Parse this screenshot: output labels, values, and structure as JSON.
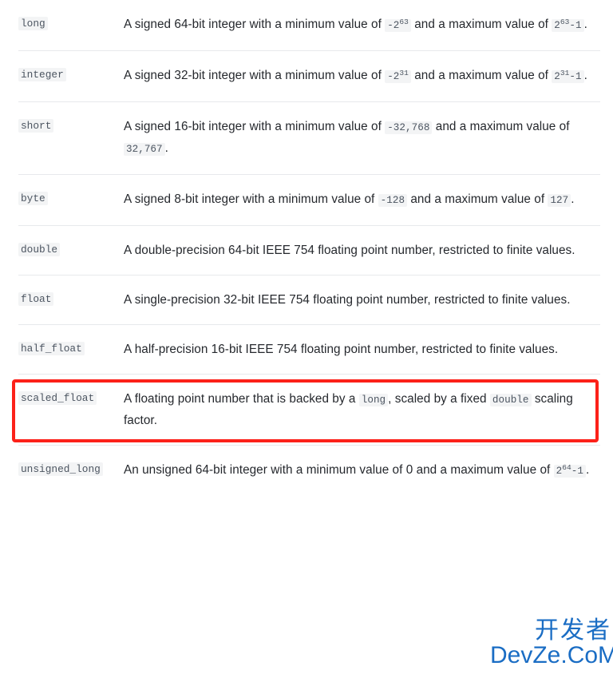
{
  "page": {
    "kind": "documentation-field-datatypes-table",
    "highlight_color": "#fc2119",
    "divider_color": "#e7e9ec",
    "code_chip_bg": "#f3f4f5",
    "code_chip_fg": "#4c5561",
    "body_text_color": "#25282d"
  },
  "watermark": {
    "line1": "开发者",
    "line2": "DevZe.CoM",
    "color": "#1a6dc4"
  },
  "rows": [
    {
      "term": "long",
      "highlighted": false,
      "desc_parts": [
        {
          "type": "text",
          "value": "A signed 64-bit integer with a minimum value of "
        },
        {
          "type": "code_pow",
          "base": "-2",
          "exp": "63",
          "tail": ""
        },
        {
          "type": "text",
          "value": " and a maximum value of "
        },
        {
          "type": "code_pow",
          "base": "2",
          "exp": "63",
          "tail": "-1"
        },
        {
          "type": "text",
          "value": "."
        }
      ],
      "desc_plain": "A signed 64-bit integer with a minimum value of -2^63 and a maximum value of 2^63-1."
    },
    {
      "term": "integer",
      "highlighted": false,
      "desc_parts": [
        {
          "type": "text",
          "value": "A signed 32-bit integer with a minimum value of "
        },
        {
          "type": "code_pow",
          "base": "-2",
          "exp": "31",
          "tail": ""
        },
        {
          "type": "text",
          "value": " and a maximum value of "
        },
        {
          "type": "code_pow",
          "base": "2",
          "exp": "31",
          "tail": "-1"
        },
        {
          "type": "text",
          "value": "."
        }
      ],
      "desc_plain": "A signed 32-bit integer with a minimum value of -2^31 and a maximum value of 2^31-1."
    },
    {
      "term": "short",
      "highlighted": false,
      "desc_parts": [
        {
          "type": "text",
          "value": "A signed 16-bit integer with a minimum value of "
        },
        {
          "type": "code",
          "value": "-32,768"
        },
        {
          "type": "text",
          "value": " and a maximum value of "
        },
        {
          "type": "code",
          "value": "32,767"
        },
        {
          "type": "text",
          "value": "."
        }
      ],
      "desc_plain": "A signed 16-bit integer with a minimum value of -32,768 and a maximum value of 32,767."
    },
    {
      "term": "byte",
      "highlighted": false,
      "desc_parts": [
        {
          "type": "text",
          "value": "A signed 8-bit integer with a minimum value of "
        },
        {
          "type": "code",
          "value": "-128"
        },
        {
          "type": "text",
          "value": " and a maximum value of "
        },
        {
          "type": "code",
          "value": "127"
        },
        {
          "type": "text",
          "value": "."
        }
      ],
      "desc_plain": "A signed 8-bit integer with a minimum value of -128 and a maximum value of 127."
    },
    {
      "term": "double",
      "highlighted": false,
      "desc_parts": [
        {
          "type": "text",
          "value": "A double-precision 64-bit IEEE 754 floating point number, restricted to finite values."
        }
      ],
      "desc_plain": "A double-precision 64-bit IEEE 754 floating point number, restricted to finite values."
    },
    {
      "term": "float",
      "highlighted": false,
      "desc_parts": [
        {
          "type": "text",
          "value": "A single-precision 32-bit IEEE 754 floating point number, restricted to finite values."
        }
      ],
      "desc_plain": "A single-precision 32-bit IEEE 754 floating point number, restricted to finite values."
    },
    {
      "term": "half_float",
      "highlighted": false,
      "desc_parts": [
        {
          "type": "text",
          "value": "A half-precision 16-bit IEEE 754 floating point number, restricted to finite values."
        }
      ],
      "desc_plain": "A half-precision 16-bit IEEE 754 floating point number, restricted to finite values."
    },
    {
      "term": "scaled_float",
      "highlighted": true,
      "desc_parts": [
        {
          "type": "text",
          "value": "A floating point number that is backed by a "
        },
        {
          "type": "code",
          "value": "long"
        },
        {
          "type": "text",
          "value": ", scaled by a fixed "
        },
        {
          "type": "code",
          "value": "double"
        },
        {
          "type": "text",
          "value": " scaling factor."
        }
      ],
      "desc_plain": "A floating point number that is backed by a long, scaled by a fixed double scaling factor."
    },
    {
      "term": "unsigned_long",
      "highlighted": false,
      "desc_parts": [
        {
          "type": "text",
          "value": "An unsigned 64-bit integer with a minimum value of 0 and a maximum value of "
        },
        {
          "type": "code_pow",
          "base": "2",
          "exp": "64",
          "tail": "-1"
        },
        {
          "type": "text",
          "value": "."
        }
      ],
      "desc_plain": "An unsigned 64-bit integer with a minimum value of 0 and a maximum value of 2^64-1."
    }
  ]
}
